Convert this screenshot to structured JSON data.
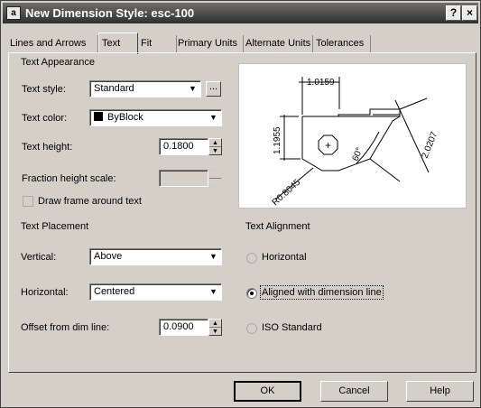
{
  "window": {
    "title": "New Dimension Style: esc-100",
    "app_icon": "autocad-icon",
    "help_button": "?",
    "close_button": "×"
  },
  "tabs": [
    {
      "label": "Lines and Arrows"
    },
    {
      "label": "Text",
      "active": true
    },
    {
      "label": "Fit"
    },
    {
      "label": "Primary Units"
    },
    {
      "label": "Alternate Units"
    },
    {
      "label": "Tolerances"
    }
  ],
  "text_appearance": {
    "heading": "Text Appearance",
    "style_label": "Text style:",
    "style_value": "Standard",
    "style_browse": "...",
    "color_label": "Text color:",
    "color_value": "ByBlock",
    "color_swatch": "#000000",
    "height_label": "Text height:",
    "height_value": "0.1800",
    "fraction_label": "Fraction height scale:",
    "fraction_value": "",
    "frame_label": "Draw frame around text",
    "frame_checked": false
  },
  "text_placement": {
    "heading": "Text Placement",
    "vertical_label": "Vertical:",
    "vertical_value": "Above",
    "horizontal_label": "Horizontal:",
    "horizontal_value": "Centered",
    "offset_label": "Offset from dim line:",
    "offset_value": "0.0900"
  },
  "text_alignment": {
    "heading": "Text Alignment",
    "options": [
      {
        "label": "Horizontal",
        "selected": false
      },
      {
        "label": "Aligned with dimension line",
        "selected": true
      },
      {
        "label": "ISO Standard",
        "selected": false
      }
    ]
  },
  "preview": {
    "dim_top": "1.0159",
    "dim_left": "1.1955",
    "dim_right": "2.0207",
    "dim_angle": "60°",
    "dim_radius": "R0.8045"
  },
  "buttons": {
    "ok": "OK",
    "cancel": "Cancel",
    "help": "Help"
  }
}
